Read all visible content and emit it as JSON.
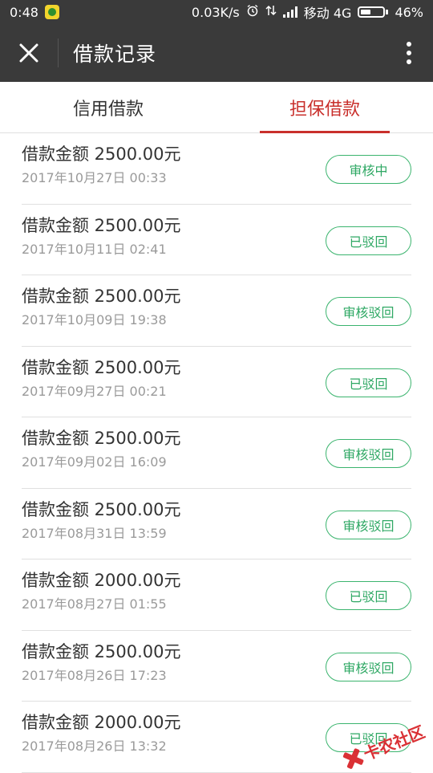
{
  "status_bar": {
    "time": "0:48",
    "speed": "0.03K/s",
    "carrier": "移动 4G",
    "battery": "46%",
    "battery_level": 0.46
  },
  "header": {
    "title": "借款记录"
  },
  "tabs": [
    {
      "label": "信用借款",
      "active": false
    },
    {
      "label": "担保借款",
      "active": true
    }
  ],
  "records": [
    {
      "amount": "借款金额 2500.00元",
      "time": "2017年10月27日 00:33",
      "status": "审核中"
    },
    {
      "amount": "借款金额 2500.00元",
      "time": "2017年10月11日 02:41",
      "status": "已驳回"
    },
    {
      "amount": "借款金额 2500.00元",
      "time": "2017年10月09日 19:38",
      "status": "审核驳回"
    },
    {
      "amount": "借款金额 2500.00元",
      "time": "2017年09月27日 00:21",
      "status": "已驳回"
    },
    {
      "amount": "借款金额 2500.00元",
      "time": "2017年09月02日 16:09",
      "status": "审核驳回"
    },
    {
      "amount": "借款金额 2500.00元",
      "time": "2017年08月31日 13:59",
      "status": "审核驳回"
    },
    {
      "amount": "借款金额 2000.00元",
      "time": "2017年08月27日 01:55",
      "status": "已驳回"
    },
    {
      "amount": "借款金额 2500.00元",
      "time": "2017年08月26日 17:23",
      "status": "审核驳回"
    },
    {
      "amount": "借款金额 2000.00元",
      "time": "2017年08月26日 13:32",
      "status": "已驳回"
    }
  ],
  "watermark": {
    "text": "卡农社区"
  },
  "colors": {
    "header_bg": "#3a3a3a",
    "active_tab": "#c9302c",
    "status_green": "#2fa864"
  }
}
